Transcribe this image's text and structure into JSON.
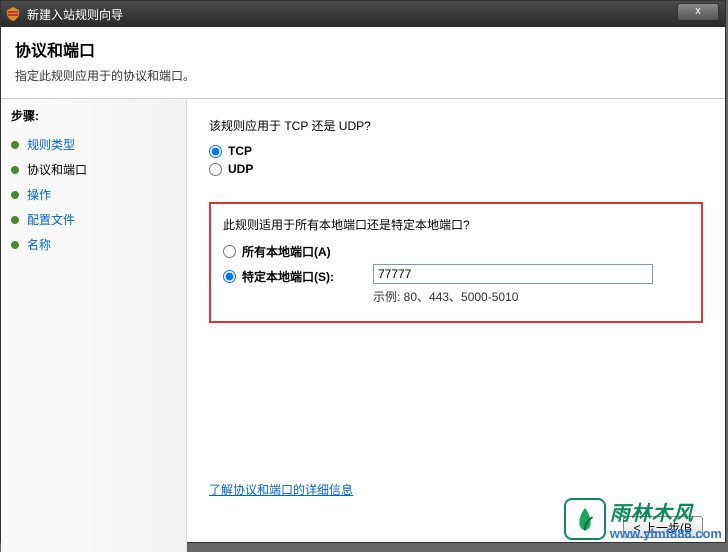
{
  "window": {
    "title": "新建入站规则向导",
    "close_label": "x"
  },
  "header": {
    "title": "协议和端口",
    "subtitle": "指定此规则应用于的协议和端口。"
  },
  "sidebar": {
    "heading": "步骤:",
    "items": [
      {
        "label": "规则类型"
      },
      {
        "label": "协议和端口"
      },
      {
        "label": "操作"
      },
      {
        "label": "配置文件"
      },
      {
        "label": "名称"
      }
    ]
  },
  "content": {
    "protocol_question": "该规则应用于 TCP 还是 UDP?",
    "tcp_label": "TCP",
    "udp_label": "UDP",
    "port_question": "此规则适用于所有本地端口还是特定本地端口?",
    "all_ports_label": "所有本地端口(A)",
    "specific_ports_label": "特定本地端口(S):",
    "port_value": "77777",
    "port_example": "示例: 80、443、5000-5010",
    "learn_more": "了解协议和端口的详细信息"
  },
  "footer": {
    "back_label": "< 上一步(B"
  },
  "watermark": {
    "brand": "雨林木风",
    "url": "www.ylmf888.com"
  }
}
